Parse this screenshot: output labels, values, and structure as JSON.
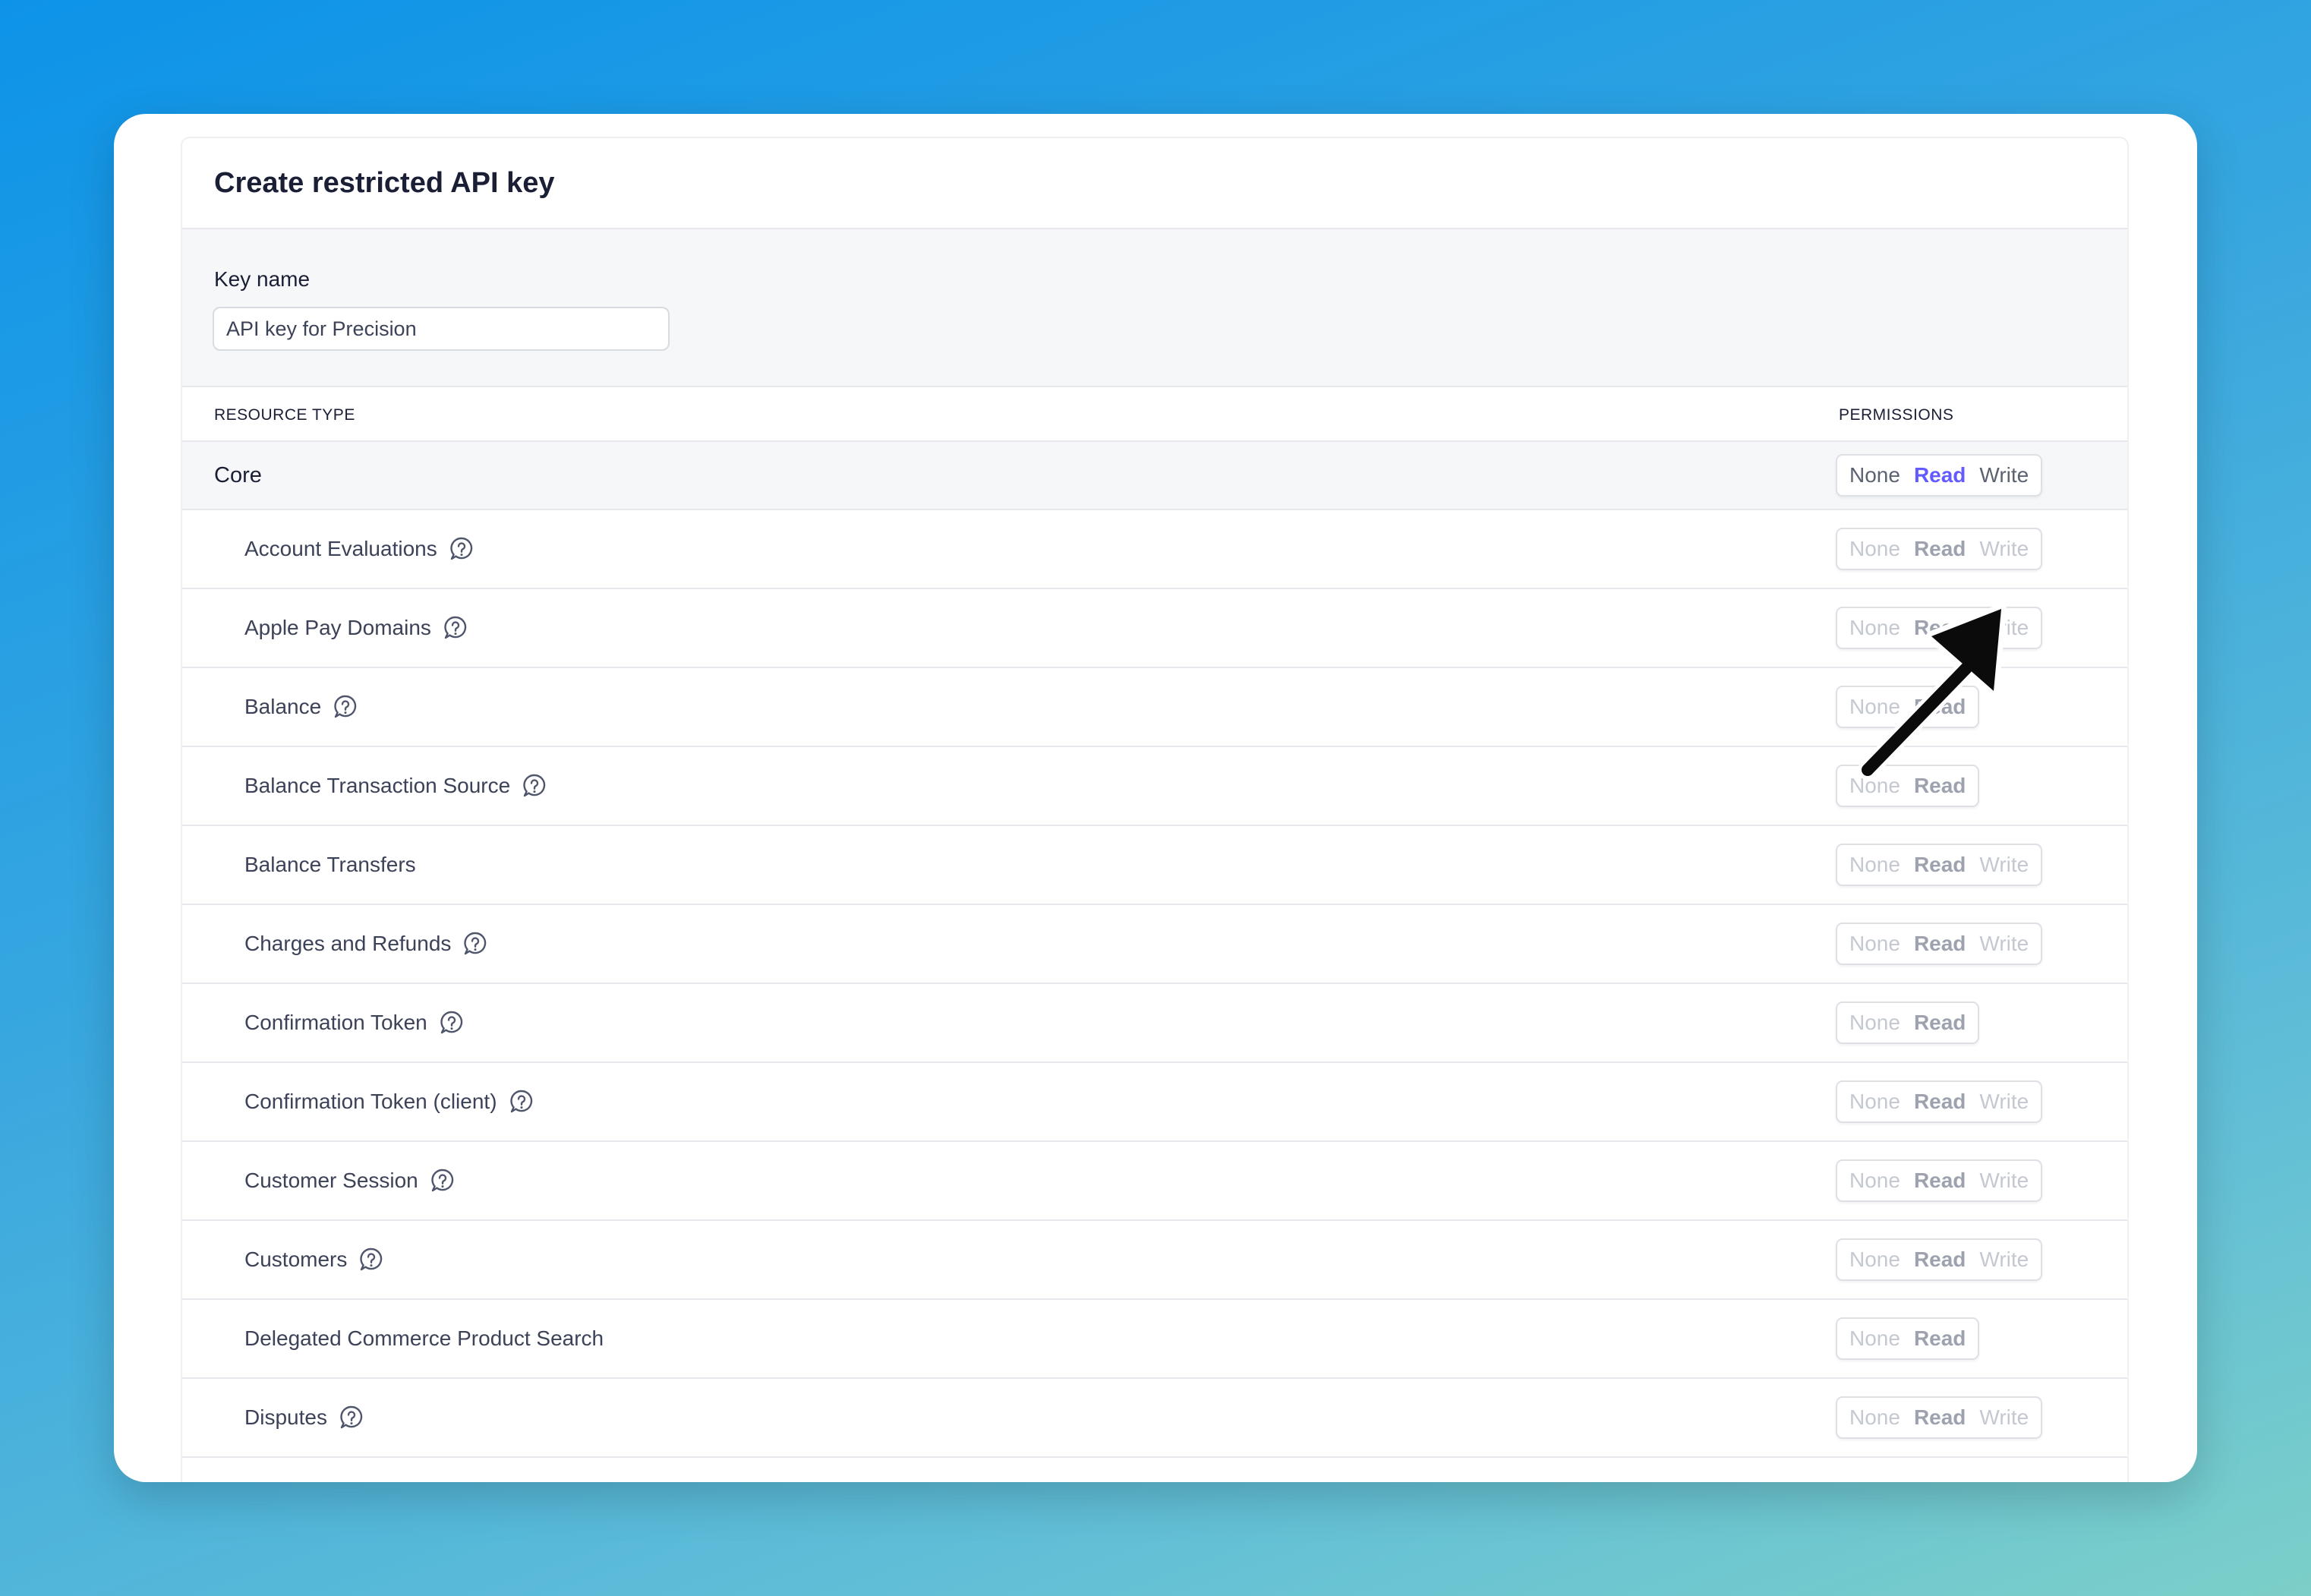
{
  "dialog": {
    "title": "Create restricted API key",
    "key_name_label": "Key name",
    "key_name_value": "API key for Precision"
  },
  "table": {
    "col_resource": "RESOURCE TYPE",
    "col_permissions": "PERMISSIONS",
    "group": {
      "label": "Core",
      "permissions": {
        "none": "None",
        "read": "Read",
        "write": "Write"
      },
      "selected": "Read"
    },
    "rows": [
      {
        "label": "Account Evaluations",
        "help": true,
        "none": "None",
        "read": "Read",
        "write": "Write"
      },
      {
        "label": "Apple Pay Domains",
        "help": true,
        "none": "None",
        "read": "Read",
        "write": "Write"
      },
      {
        "label": "Balance",
        "help": true,
        "none": "None",
        "read": "Read"
      },
      {
        "label": "Balance Transaction Source",
        "help": true,
        "none": "None",
        "read": "Read"
      },
      {
        "label": "Balance Transfers",
        "help": false,
        "none": "None",
        "read": "Read",
        "write": "Write"
      },
      {
        "label": "Charges and Refunds",
        "help": true,
        "none": "None",
        "read": "Read",
        "write": "Write"
      },
      {
        "label": "Confirmation Token",
        "help": true,
        "none": "None",
        "read": "Read"
      },
      {
        "label": "Confirmation Token (client)",
        "help": true,
        "none": "None",
        "read": "Read",
        "write": "Write"
      },
      {
        "label": "Customer Session",
        "help": true,
        "none": "None",
        "read": "Read",
        "write": "Write"
      },
      {
        "label": "Customers",
        "help": true,
        "none": "None",
        "read": "Read",
        "write": "Write"
      },
      {
        "label": "Delegated Commerce Product Search",
        "help": false,
        "none": "None",
        "read": "Read"
      },
      {
        "label": "Disputes",
        "help": true,
        "none": "None",
        "read": "Read",
        "write": "Write"
      }
    ]
  },
  "colors": {
    "accent": "#635bff",
    "muted": "#c4c8d0"
  },
  "icons": {
    "help": "question-bubble-icon",
    "pointer": "arrow-icon"
  }
}
